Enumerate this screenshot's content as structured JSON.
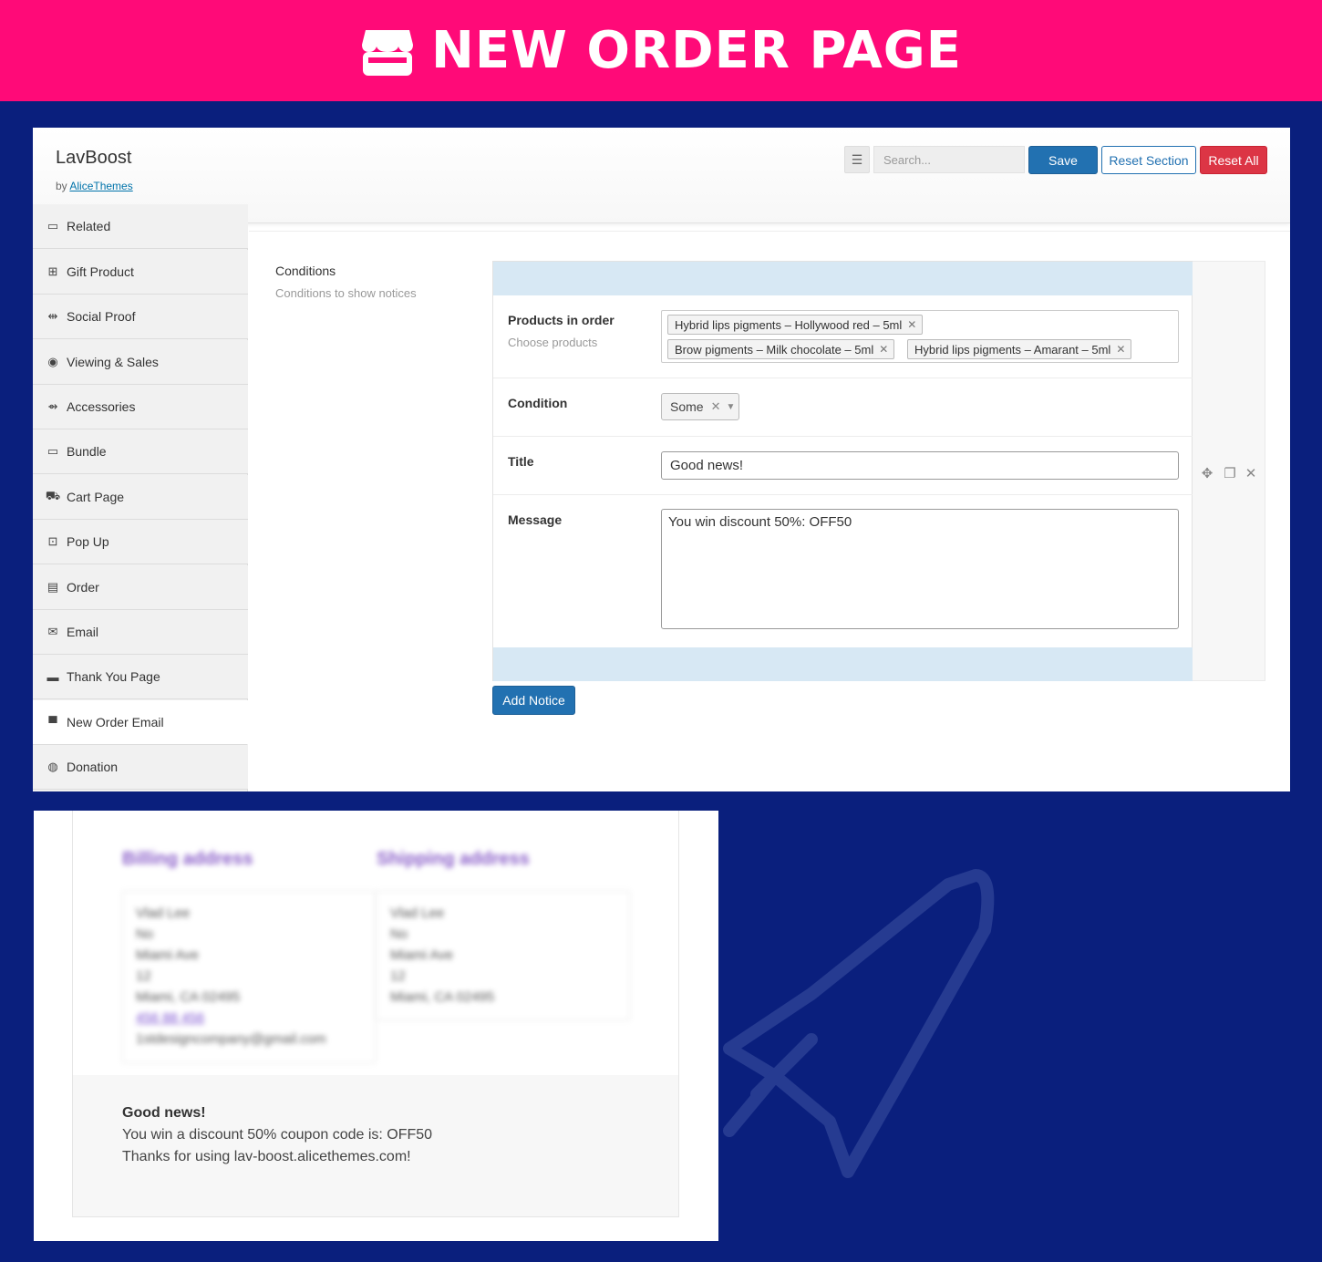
{
  "banner": {
    "title": "NEW ORDER PAGE",
    "icon": "store-icon"
  },
  "header": {
    "app_name": "LavBoost",
    "by_prefix": "by",
    "by_link": "AliceThemes",
    "search_placeholder": "Search...",
    "save_label": "Save",
    "reset_section_label": "Reset Section",
    "reset_all_label": "Reset All"
  },
  "sidebar": {
    "items": [
      {
        "label": "Related",
        "icon": "laptop-icon"
      },
      {
        "label": "Gift Product",
        "icon": "gift-icon"
      },
      {
        "label": "Social Proof",
        "icon": "social-icon"
      },
      {
        "label": "Viewing & Sales",
        "icon": "eye-icon"
      },
      {
        "label": "Accessories",
        "icon": "usb-icon"
      },
      {
        "label": "Bundle",
        "icon": "laptop-icon"
      },
      {
        "label": "Cart Page",
        "icon": "cart-icon"
      },
      {
        "label": "Pop Up",
        "icon": "popup-icon"
      },
      {
        "label": "Order",
        "icon": "document-icon"
      },
      {
        "label": "Email",
        "icon": "envelope-icon"
      },
      {
        "label": "Thank You Page",
        "icon": "card-icon"
      },
      {
        "label": "New Order Email",
        "icon": "store-icon",
        "active": true
      },
      {
        "label": "Donation",
        "icon": "donation-icon"
      }
    ]
  },
  "conditions": {
    "title": "Conditions",
    "subtitle": "Conditions to show notices"
  },
  "notice": {
    "products_label": "Products in order",
    "products_hint": "Choose products",
    "products": [
      "Hybrid lips pigments – Hollywood red – 5ml",
      "Brow pigments – Milk chocolate – 5ml",
      "Hybrid lips pigments – Amarant – 5ml"
    ],
    "condition_label": "Condition",
    "condition_value": "Some",
    "title_label": "Title",
    "title_value": "Good news!",
    "message_label": "Message",
    "message_value": "You win discount 50%: OFF50",
    "add_notice_label": "Add Notice"
  },
  "email_preview": {
    "billing_heading": "Billing address",
    "shipping_heading": "Shipping address",
    "billing_lines": [
      "Vlad Lee",
      "No",
      "Miami Ave",
      "12",
      "Miami, CA 02495"
    ],
    "billing_phone": "456 88 456",
    "billing_email": "1stdesigncompany@gmail.com",
    "shipping_lines": [
      "Vlad Lee",
      "No",
      "Miami Ave",
      "12",
      "Miami, CA 02495"
    ],
    "notice_title": "Good news!",
    "notice_line1": "You win a discount 50% coupon code is: OFF50",
    "notice_line2": "Thanks for using lav-boost.alicethemes.com!"
  },
  "colors": {
    "banner_bg": "#ff0a78",
    "page_bg": "#0a1f7d",
    "primary": "#2271b1",
    "danger": "#dc3545",
    "notice_band": "#d7e8f4"
  }
}
